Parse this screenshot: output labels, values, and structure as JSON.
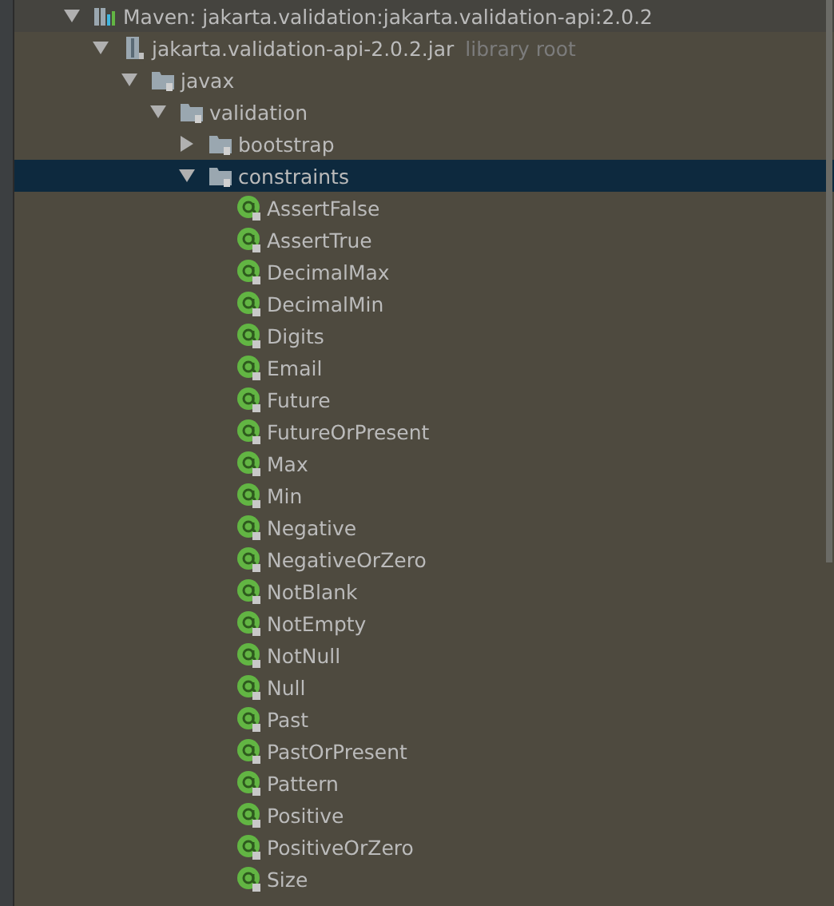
{
  "tree": [
    {
      "label": "Maven: jakarta.validation:jakarta.validation-api:2.0.2",
      "kind": "library",
      "expanded": true,
      "selected": false,
      "children": [
        {
          "label": "jakarta.validation-api-2.0.2.jar",
          "note": "library root",
          "kind": "jar",
          "expanded": true,
          "selected": false,
          "children": [
            {
              "label": "javax",
              "kind": "package",
              "expanded": true,
              "selected": false,
              "children": [
                {
                  "label": "validation",
                  "kind": "package",
                  "expanded": true,
                  "selected": false,
                  "children": [
                    {
                      "label": "bootstrap",
                      "kind": "package",
                      "expanded": false,
                      "selected": false
                    },
                    {
                      "label": "constraints",
                      "kind": "package",
                      "expanded": true,
                      "selected": true,
                      "children": [
                        {
                          "label": "AssertFalse",
                          "kind": "annotation",
                          "selected": false
                        },
                        {
                          "label": "AssertTrue",
                          "kind": "annotation",
                          "selected": false
                        },
                        {
                          "label": "DecimalMax",
                          "kind": "annotation",
                          "selected": false
                        },
                        {
                          "label": "DecimalMin",
                          "kind": "annotation",
                          "selected": false
                        },
                        {
                          "label": "Digits",
                          "kind": "annotation",
                          "selected": false
                        },
                        {
                          "label": "Email",
                          "kind": "annotation",
                          "selected": false
                        },
                        {
                          "label": "Future",
                          "kind": "annotation",
                          "selected": false
                        },
                        {
                          "label": "FutureOrPresent",
                          "kind": "annotation",
                          "selected": false
                        },
                        {
                          "label": "Max",
                          "kind": "annotation",
                          "selected": false
                        },
                        {
                          "label": "Min",
                          "kind": "annotation",
                          "selected": false
                        },
                        {
                          "label": "Negative",
                          "kind": "annotation",
                          "selected": false
                        },
                        {
                          "label": "NegativeOrZero",
                          "kind": "annotation",
                          "selected": false
                        },
                        {
                          "label": "NotBlank",
                          "kind": "annotation",
                          "selected": false
                        },
                        {
                          "label": "NotEmpty",
                          "kind": "annotation",
                          "selected": false
                        },
                        {
                          "label": "NotNull",
                          "kind": "annotation",
                          "selected": false
                        },
                        {
                          "label": "Null",
                          "kind": "annotation",
                          "selected": false
                        },
                        {
                          "label": "Past",
                          "kind": "annotation",
                          "selected": false
                        },
                        {
                          "label": "PastOrPresent",
                          "kind": "annotation",
                          "selected": false
                        },
                        {
                          "label": "Pattern",
                          "kind": "annotation",
                          "selected": false
                        },
                        {
                          "label": "Positive",
                          "kind": "annotation",
                          "selected": false
                        },
                        {
                          "label": "PositiveOrZero",
                          "kind": "annotation",
                          "selected": false
                        },
                        {
                          "label": "Size",
                          "kind": "annotation",
                          "selected": false
                        }
                      ]
                    }
                  ]
                }
              ]
            }
          ]
        }
      ]
    }
  ]
}
